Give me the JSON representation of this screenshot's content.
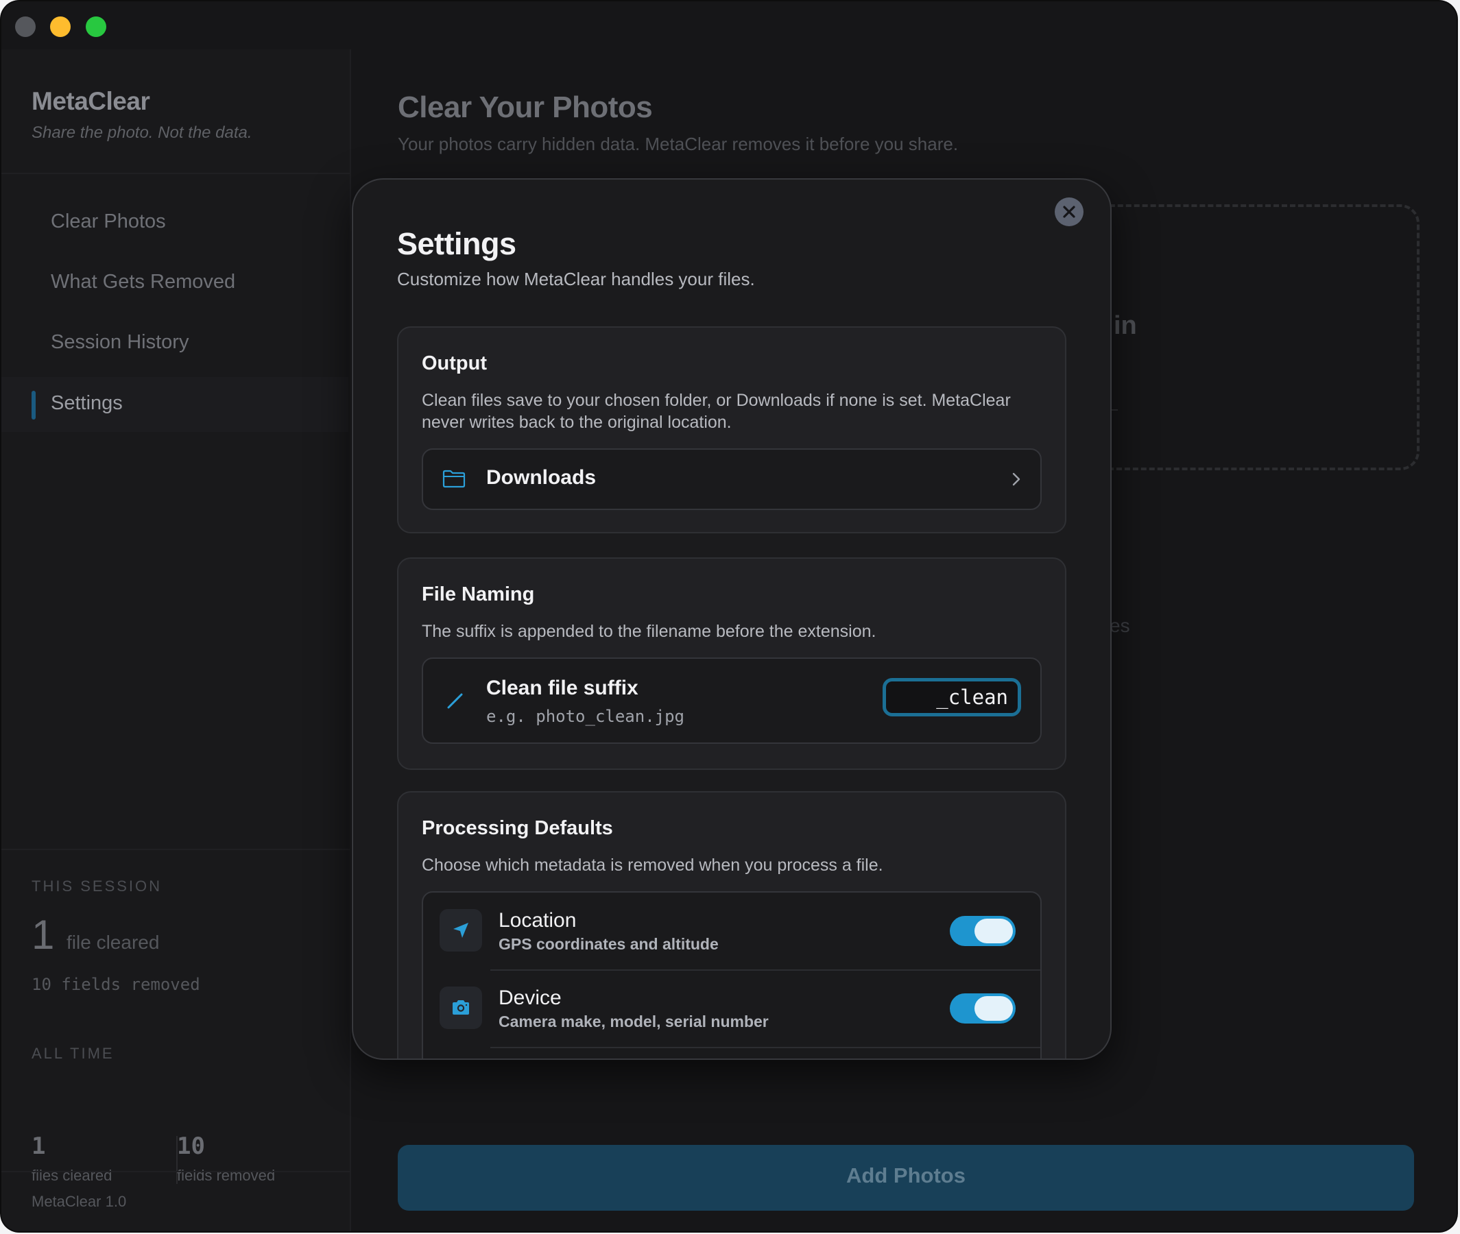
{
  "app": {
    "name": "MetaClear",
    "tagline": "Share the photo. Not the data.",
    "version": "MetaClear 1.0"
  },
  "sidebar": {
    "nav": [
      {
        "label": "Clear Photos",
        "active": false
      },
      {
        "label": "What Gets Removed",
        "active": false
      },
      {
        "label": "Session History",
        "active": false
      },
      {
        "label": "Settings",
        "active": true
      }
    ],
    "this_session": {
      "heading": "THIS SESSION",
      "count": "1",
      "count_label": "file cleared",
      "fields": "10 fields removed"
    },
    "all_time": {
      "heading": "ALL TIME",
      "files": "1",
      "files_label": "files cleared",
      "fields": "10",
      "fields_label": "fields removed"
    }
  },
  "main": {
    "title": "Clear Your Photos",
    "subtitle": "Your photos carry hidden data. MetaClear removes it before you share.",
    "partial_drop_text": "in",
    "partial_text_2": "es",
    "add_button": "Add Photos"
  },
  "modal": {
    "title": "Settings",
    "subtitle": "Customize how MetaClear handles your files.",
    "output": {
      "title": "Output",
      "description": "Clean files save to your chosen folder, or Downloads if none is set. MetaClear never writes back to the original location.",
      "folder": "Downloads"
    },
    "naming": {
      "title": "File Naming",
      "description": "The suffix is appended to the filename before the extension.",
      "label": "Clean file suffix",
      "example": "e.g. photo_clean.jpg",
      "value": "_clean"
    },
    "processing": {
      "title": "Processing Defaults",
      "description": "Choose which metadata is removed when you process a file.",
      "items": [
        {
          "label": "Location",
          "description": "GPS coordinates and altitude",
          "enabled": true,
          "icon": "location-arrow-icon"
        },
        {
          "label": "Device",
          "description": "Camera make, model, serial number",
          "enabled": true,
          "icon": "camera-icon"
        }
      ]
    }
  },
  "colors": {
    "accent": "#1e95cf",
    "accent_dark": "#184058",
    "window_bg": "#161618",
    "modal_bg": "#1b1b1d"
  }
}
